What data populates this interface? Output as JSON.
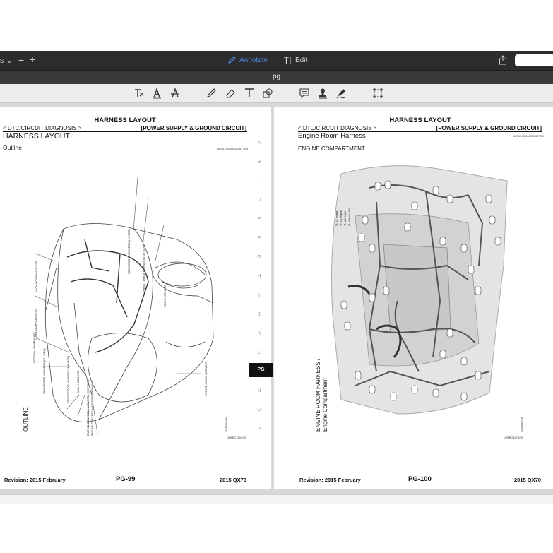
{
  "toolbar": {
    "annotate_label": "Annotate",
    "edit_label": "Edit",
    "document_title": "pg",
    "left_edge": "s",
    "tools": [
      "text-select-icon",
      "font-icon",
      "strikethrough-icon",
      "pen-icon",
      "eraser-icon",
      "text-icon",
      "shapes-icon",
      "comment-icon",
      "stamp-icon",
      "signature-icon",
      "crop-icon"
    ]
  },
  "page_left": {
    "header_center": "HARNESS LAYOUT",
    "breadcrumb": "< DTC/CIRCUIT DIAGNOSIS >",
    "section": "[POWER SUPPLY & GROUND CIRCUIT]",
    "title": "HARNESS LAYOUT",
    "subtitle": "Outline",
    "info_code": "INFOID:0000000010577249",
    "harness_labels": [
      "REAR DOOR HARNESS (LH SIDE)",
      "FRONT DOOR HARNESS (LH SIDE)",
      "BODY HARNESS",
      "BACK DOOR HARNESS",
      "ROOM LAMP HARNESS",
      "BODY No. 2 HARNESS",
      "REAR DOOR HARNESS (RH SIDE)",
      "FRONT DOOR HARNESS (RH SIDE)",
      "MAIN HARNESS",
      "ENGINE CONTROL HARNESS (VQ37VHR)",
      "ENGINE CONTROL HARNESS (VK50VE)",
      "ENGINE ROOM HARNESS"
    ],
    "figure_vertical_label": "OUTLINE",
    "figure_date": "2015/06/05",
    "figure_code": "JRMIC1607GB",
    "footer_revision": "Revision: 2015 February",
    "page_number": "PG-99",
    "footer_model": "2015 QX70"
  },
  "page_right": {
    "header_center": "HARNESS LAYOUT",
    "breadcrumb": "< DTC/CIRCUIT DIAGNOSIS >",
    "section": "[POWER SUPPLY & GROUND CIRCUIT]",
    "title": "Engine Room Harness",
    "subtitle": "ENGINE COMPARTMENT",
    "info_code": "INFOID:0000000010577250",
    "legend": [
      "*1: VK engine",
      "*2: VQ engine",
      "*3: With NAVI",
      "*4: Without NAVI"
    ],
    "figure_vertical_label_1": "ENGINE ROOM HARNESS /",
    "figure_vertical_label_2": "Engine Compartment",
    "figure_date": "2014/09/18",
    "figure_code": "JRMIC4470GB",
    "footer_revision": "Revision: 2015 February",
    "page_number": "PG-100",
    "footer_model": "2015 QX70"
  },
  "section_index": {
    "letters": [
      "A",
      "B",
      "C",
      "D",
      "E",
      "F",
      "G",
      "H",
      "I",
      "J",
      "K",
      "L",
      "PG",
      "N",
      "O",
      "P"
    ],
    "active": "PG"
  },
  "colors": {
    "accent": "#4a86d8",
    "toolbar_bg": "#2c2c2e",
    "active_tab": "#111111"
  }
}
